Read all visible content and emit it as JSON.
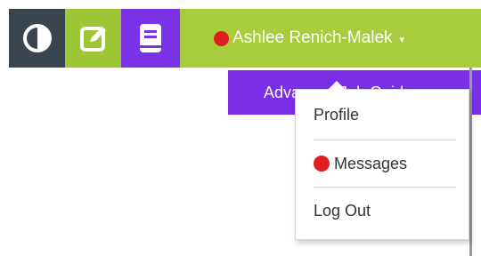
{
  "topbar": {
    "icons": {
      "contrast": "contrast-icon",
      "edit": "edit-icon",
      "guide": "book-icon"
    },
    "user": {
      "name": "Ashlee Renich-Malek",
      "caret": "▾",
      "has_notification": true
    },
    "colors": {
      "contrast_bg": "#3a4550",
      "edit_bg": "#9dc634",
      "guide_bg": "#7a33e6",
      "user_bg": "#a9cc3c",
      "notification": "#e01e1e"
    }
  },
  "sub_bar": {
    "label": "Advanced Job Guide",
    "color": "#7a2fe6"
  },
  "dropdown": {
    "items": [
      {
        "label": "Profile",
        "has_dot": false
      },
      {
        "label": "Messages",
        "has_dot": true
      },
      {
        "label": "Log Out",
        "has_dot": false
      }
    ]
  }
}
